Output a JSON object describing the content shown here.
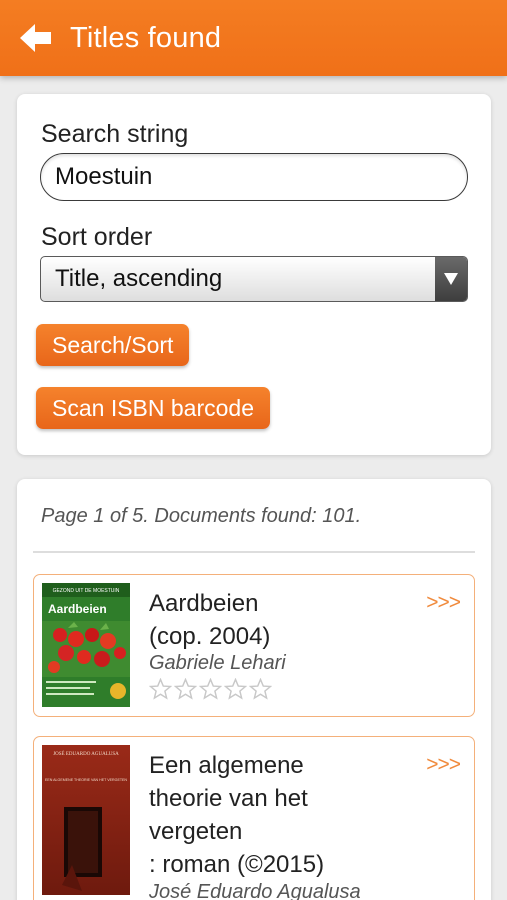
{
  "header": {
    "title": "Titles found",
    "back_icon": "arrow-left-icon"
  },
  "search": {
    "string_label": "Search string",
    "string_value": "Moestuin",
    "sort_label": "Sort order",
    "sort_value": "Title, ascending",
    "search_button": "Search/Sort",
    "scan_button": "Scan ISBN barcode"
  },
  "results": {
    "page_info": "Page 1 of 5. Documents found: 101.",
    "more_label": ">>>",
    "items": [
      {
        "title_line1": "Aardbeien",
        "title_line2": "(cop. 2004)",
        "author": "Gabriele Lehari",
        "rating": 0,
        "max_rating": 5,
        "cover_series": "GEZOND UIT DE MOESTUIN",
        "cover_title": "Aardbeien"
      },
      {
        "title_line1": "Een algemene",
        "title_line2": "theorie van het",
        "title_line3": "vergeten",
        "title_line4": ": roman (©2015)",
        "author": "José Eduardo Agualusa",
        "cover_author": "JOSÉ EDUARDO AGUALUSA",
        "cover_subtitle": "EEN ALGEMENE THEORIE VAN HET VERGETEN"
      }
    ]
  },
  "colors": {
    "accent": "#f07018",
    "result_border": "#f4b07a",
    "more_link": "#f08a3c",
    "star_outline": "#c8c8c8"
  }
}
